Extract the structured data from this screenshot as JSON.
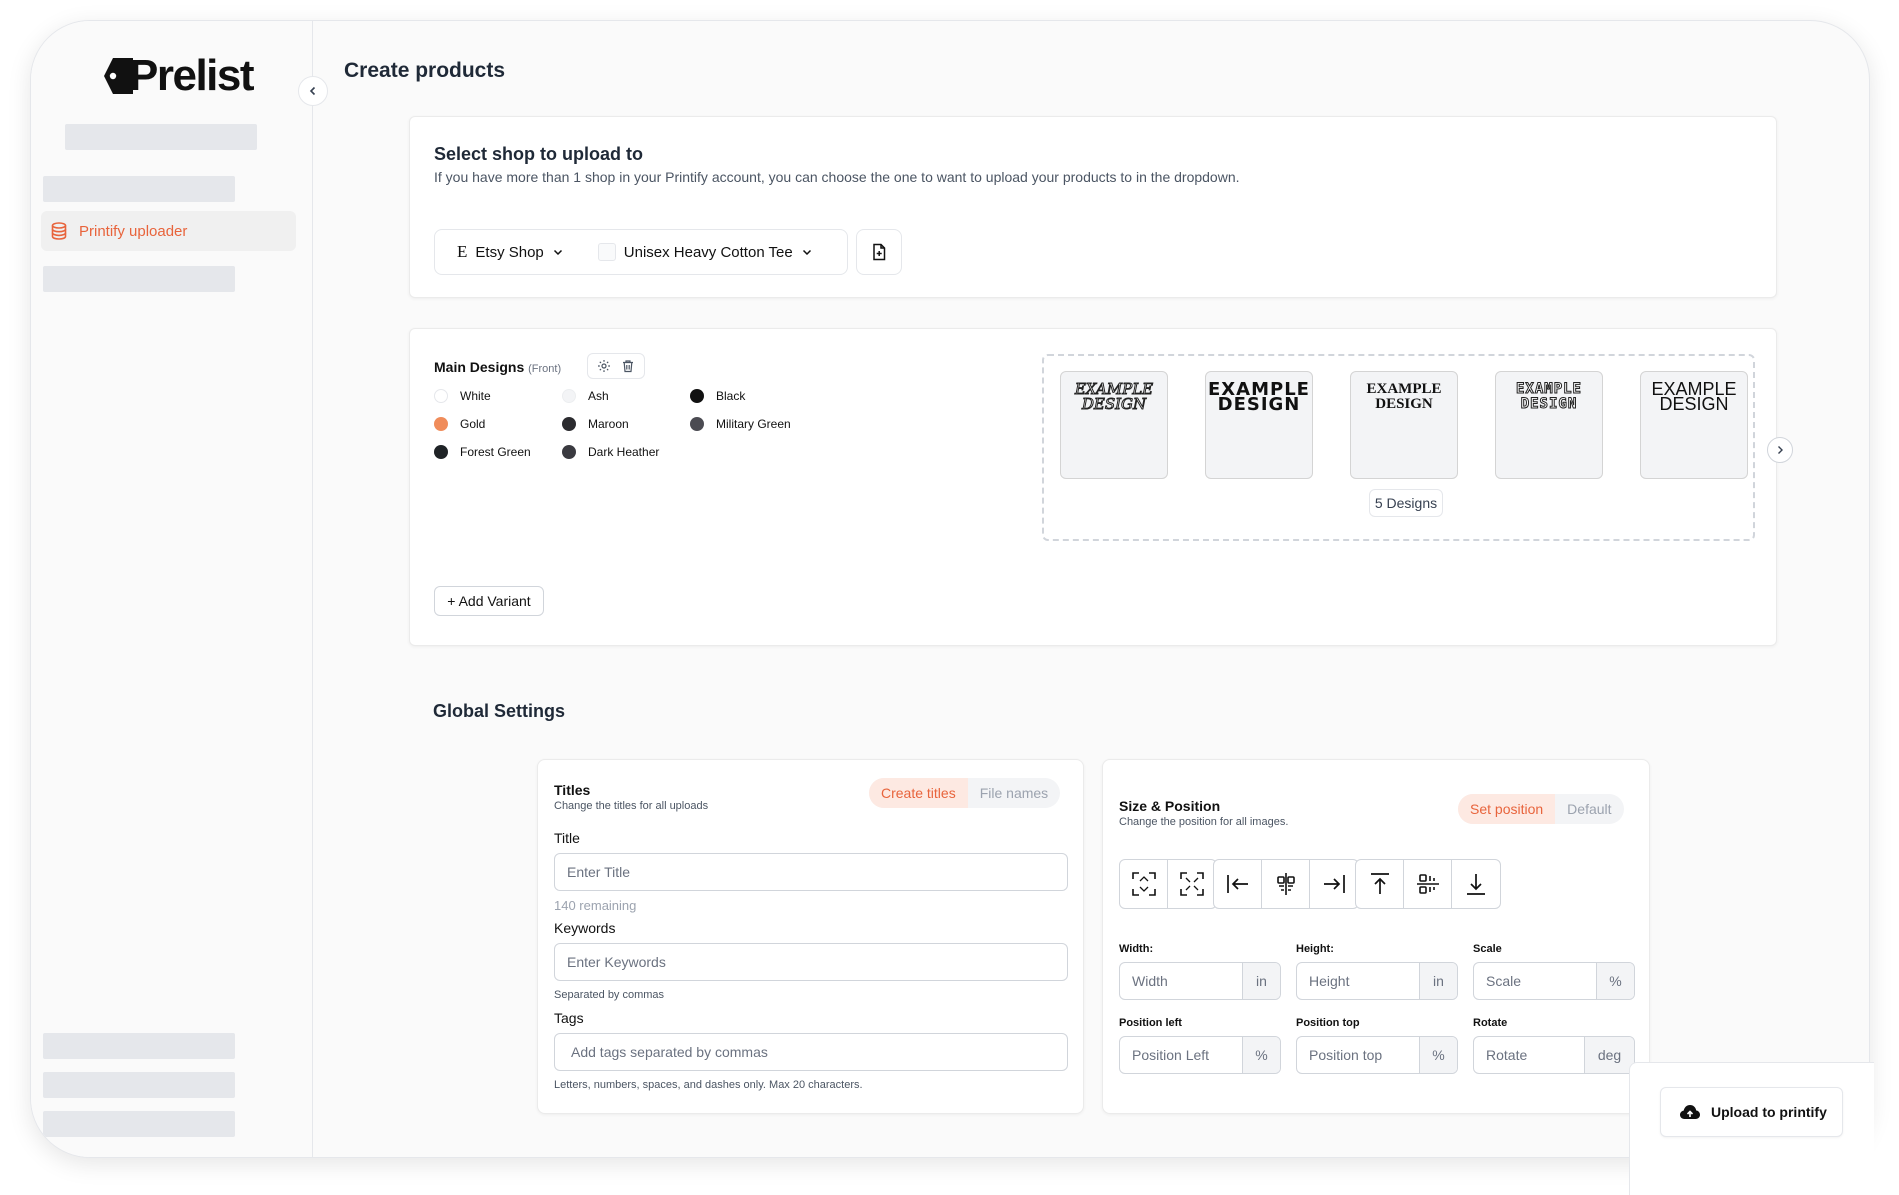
{
  "app": {
    "logo_text": "Prelist",
    "accent_color": "#e8643c"
  },
  "sidebar": {
    "active_item": {
      "label": "Printify uploader",
      "icon": "database-icon"
    }
  },
  "page": {
    "title": "Create products"
  },
  "shop_card": {
    "title": "Select shop to upload to",
    "description": "If you have more than 1 shop in your Printify account, you can choose the one to want to upload your products to in the dropdown.",
    "shop_select": {
      "icon": "etsy-icon",
      "glyph": "E",
      "value": "Etsy Shop"
    },
    "product_select": {
      "value": "Unisex Heavy Cotton Tee"
    },
    "file_button_icon": "file-plus-icon"
  },
  "designs_card": {
    "title": "Main Designs",
    "subtitle": "(Front)",
    "colors": [
      {
        "name": "White",
        "hex": "#ffffff"
      },
      {
        "name": "Ash",
        "hex": "#f3f4f6"
      },
      {
        "name": "Black",
        "hex": "#111111"
      },
      {
        "name": "Gold",
        "hex": "#f08c5a"
      },
      {
        "name": "Maroon",
        "hex": "#2b2b2f"
      },
      {
        "name": "Military Green",
        "hex": "#4b4b52"
      },
      {
        "name": "Forest Green",
        "hex": "#1f2326"
      },
      {
        "name": "Dark Heather",
        "hex": "#3a3a40"
      }
    ],
    "design_thumbnails": [
      {
        "line1": "EXAMPLE",
        "line2": "DESIGN"
      },
      {
        "line1": "EXAMPLE",
        "line2": "DESIGN"
      },
      {
        "line1": "EXAMPLE",
        "line2": "DESIGN"
      },
      {
        "line1": "EXAMPLE",
        "line2": "DESIGN"
      },
      {
        "line1": "EXAMPLE",
        "line2": "DESIGN"
      }
    ],
    "design_count": "5 Designs",
    "add_variant_label": "+ Add Variant"
  },
  "global_settings": {
    "title": "Global Settings",
    "titles_card": {
      "title": "Titles",
      "description": "Change the titles for all uploads",
      "toggle": {
        "active": "Create titles",
        "inactive": "File names"
      },
      "title_field": {
        "label": "Title",
        "placeholder": "Enter Title",
        "hint": "140 remaining"
      },
      "keywords_field": {
        "label": "Keywords",
        "placeholder": "Enter Keywords",
        "hint": "Separated by commas"
      },
      "tags_field": {
        "label": "Tags",
        "placeholder": "Add tags separated by commas",
        "hint": "Letters, numbers, spaces, and dashes only. Max 20 characters."
      }
    },
    "position_card": {
      "title": "Size & Position",
      "description": "Change the position for all images.",
      "toggle": {
        "active": "Set position",
        "inactive": "Default"
      },
      "fields": {
        "width": {
          "label": "Width:",
          "placeholder": "Width",
          "unit": "in"
        },
        "height": {
          "label": "Height:",
          "placeholder": "Height",
          "unit": "in"
        },
        "scale": {
          "label": "Scale",
          "placeholder": "Scale",
          "unit": "%"
        },
        "position_left": {
          "label": "Position left",
          "placeholder": "Position Left",
          "unit": "%"
        },
        "position_top": {
          "label": "Position top",
          "placeholder": "Position top",
          "unit": "%"
        },
        "rotate": {
          "label": "Rotate",
          "placeholder": "Rotate",
          "unit": "deg"
        }
      }
    }
  },
  "upload": {
    "label": "Upload to printify",
    "icon": "cloud-upload-icon"
  }
}
